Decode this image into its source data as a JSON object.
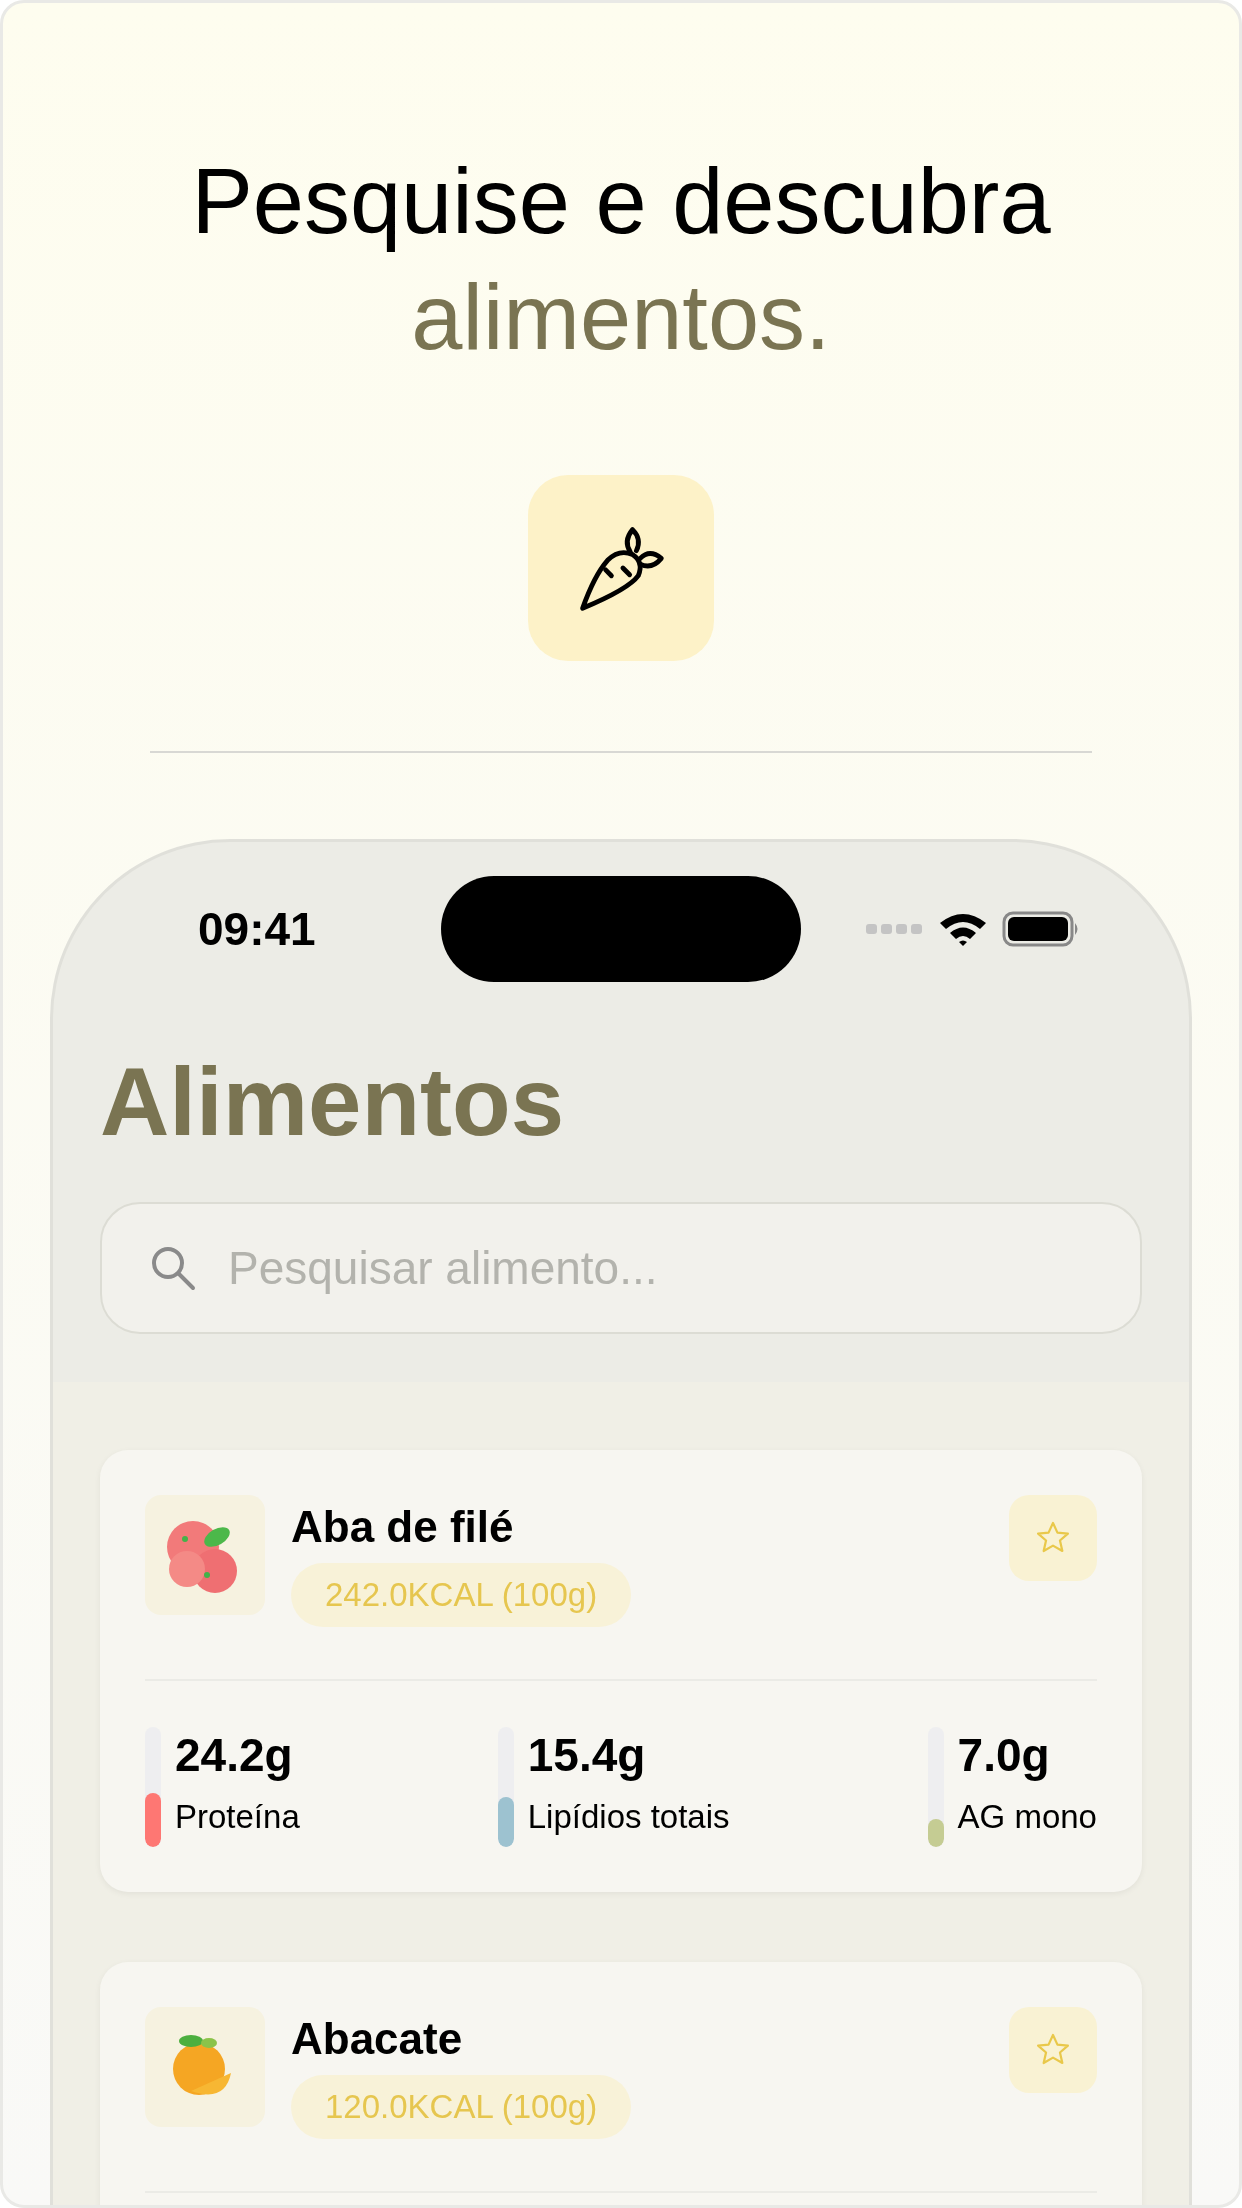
{
  "headline": {
    "text": "Pesquise e descubra",
    "highlight": "alimentos."
  },
  "phone": {
    "status_bar": {
      "time": "09:41"
    },
    "title": "Alimentos",
    "search": {
      "placeholder": "Pesquisar alimento..."
    },
    "foods": [
      {
        "name": "Aba de filé",
        "calories": "242.0KCAL (100g)",
        "favorite": false,
        "nutrients": [
          {
            "value": "24.2g",
            "label": "Proteína",
            "level": 0.45,
            "color": "#fe7773"
          },
          {
            "value": "15.4g",
            "label": "Lipídios totais",
            "level": 0.42,
            "color": "#9dc2d0"
          },
          {
            "value": "7.0g",
            "label": "AG mono",
            "level": 0.23,
            "color": "#c5cc93"
          }
        ]
      },
      {
        "name": "Abacate",
        "calories": "120.0KCAL (100g)",
        "favorite": false
      }
    ]
  }
}
